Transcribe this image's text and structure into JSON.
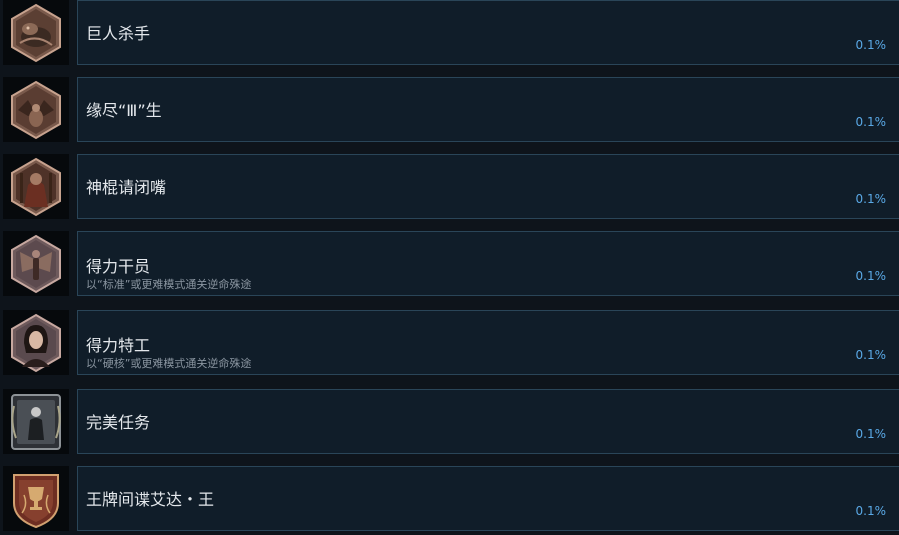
{
  "achievements": [
    {
      "name": "巨人杀手",
      "description": "",
      "percent": "0.1%",
      "icon": "giant-creature-icon",
      "badge_shape": "hexagon"
    },
    {
      "name": "缘尽“Ⅲ”生",
      "description": "",
      "percent": "0.1%",
      "icon": "winged-creature-icon",
      "badge_shape": "hexagon"
    },
    {
      "name": "神棍请闭嘴",
      "description": "",
      "percent": "0.1%",
      "icon": "robed-figure-icon",
      "badge_shape": "hexagon"
    },
    {
      "name": "得力干员",
      "description": "以“标准”或更难模式通关逆命殊途",
      "percent": "0.1%",
      "icon": "winged-angel-icon",
      "badge_shape": "hexagon"
    },
    {
      "name": "得力特工",
      "description": "以“硬核”或更难模式通关逆命殊途",
      "percent": "0.1%",
      "icon": "woman-portrait-icon",
      "badge_shape": "hexagon"
    },
    {
      "name": "完美任务",
      "description": "",
      "percent": "0.1%",
      "icon": "agent-in-suit-icon",
      "badge_shape": "laurel-frame"
    },
    {
      "name": "王牌间谍艾达・王",
      "description": "",
      "percent": "0.1%",
      "icon": "trophy-shield-icon",
      "badge_shape": "shield"
    }
  ],
  "colors": {
    "background": "#0e141b",
    "card_background": "#101d29",
    "card_border": "#2a4558",
    "title_text": "#e4e8ec",
    "description_text": "#8a95a0",
    "percent_text": "#5aa9e6"
  }
}
